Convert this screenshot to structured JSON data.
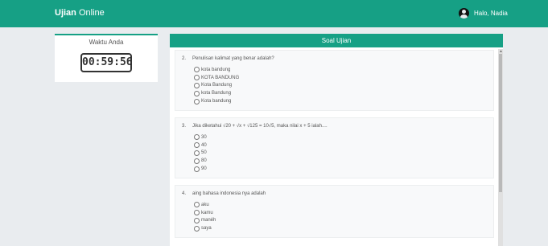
{
  "navbar": {
    "brand_bold": "Ujian",
    "brand_rest": "Online",
    "user_text": "Halo, Nadia"
  },
  "timer": {
    "title": "Waktu Anda",
    "value": "00:59:56"
  },
  "exam": {
    "title": "Soal Ujian",
    "questions": [
      {
        "number": "2.",
        "text": "Penulisan kalimat yang benar adalah?",
        "options": [
          "kota bandung",
          "KOTA BANDUNG",
          "Kota Bandung",
          "kota Bandung",
          "Kota bandung"
        ]
      },
      {
        "number": "3.",
        "text": "Jika diketahui √20 + √x + √125 = 10√5, maka nilai x + 5 ialah....",
        "options": [
          "30",
          "40",
          "50",
          "80",
          "90"
        ]
      },
      {
        "number": "4.",
        "text": "aing bahasa indonesia nya adalah",
        "options": [
          "aku",
          "kamu",
          "manéh",
          "saya"
        ]
      }
    ]
  },
  "colors": {
    "accent": "#16a085",
    "background": "#e9ecef"
  },
  "icons": {
    "user": "user-avatar-icon",
    "radio": "radio-button"
  }
}
